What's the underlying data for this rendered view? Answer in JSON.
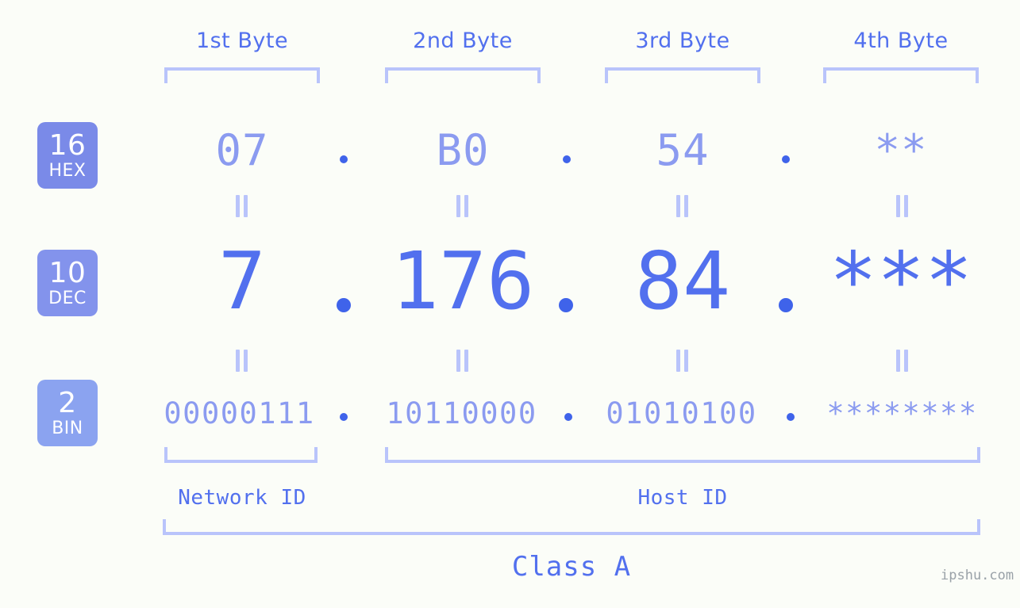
{
  "page": {
    "background_color": "#fbfdf8",
    "accent_strong": "#5270ee",
    "accent_mid": "#8b9bf0",
    "accent_light": "#b9c4fb",
    "watermark": "ipshu.com"
  },
  "byte_headers": [
    {
      "label": "1st Byte"
    },
    {
      "label": "2nd Byte"
    },
    {
      "label": "3rd Byte"
    },
    {
      "label": "4th Byte"
    }
  ],
  "rows": [
    {
      "badge_number": "16",
      "badge_abbr": "HEX",
      "badge_color": "#7a8ae8",
      "values": [
        "07",
        "B0",
        "54",
        "**"
      ],
      "separators": [
        ".",
        ".",
        "."
      ]
    },
    {
      "badge_number": "10",
      "badge_abbr": "DEC",
      "badge_color": "#8393ec",
      "values": [
        "7",
        "176",
        "84",
        "***"
      ],
      "separators": [
        ".",
        ".",
        "."
      ]
    },
    {
      "badge_number": "2",
      "badge_abbr": "BIN",
      "badge_color": "#8ba3f0",
      "values": [
        "00000111",
        "10110000",
        "01010100",
        "********"
      ],
      "separators": [
        ".",
        ".",
        "."
      ]
    }
  ],
  "equality_marks": {
    "symbol": "=",
    "count_per_gap": 4,
    "gaps": 2
  },
  "id_groups": [
    {
      "label": "Network ID"
    },
    {
      "label": "Host ID"
    }
  ],
  "class_group": {
    "label": "Class A"
  }
}
